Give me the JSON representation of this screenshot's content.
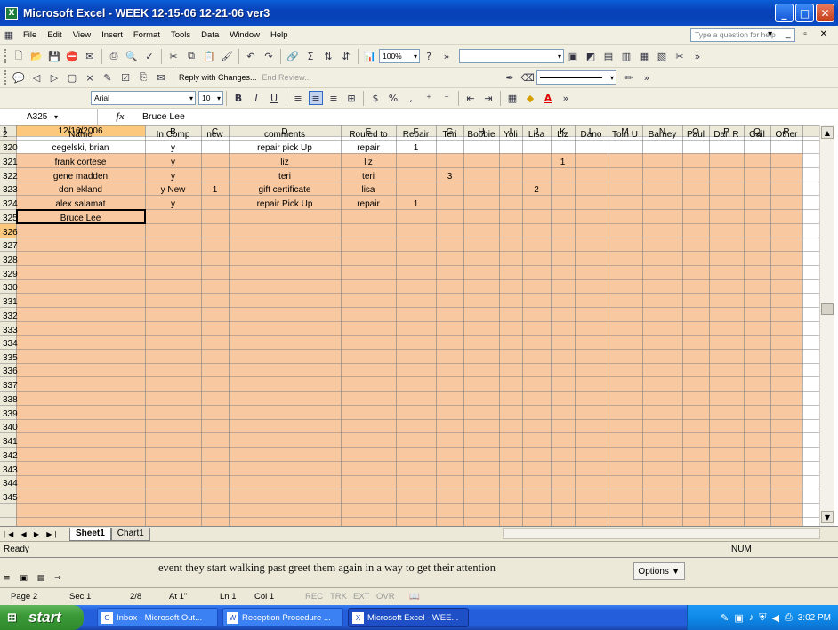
{
  "window": {
    "title": "Microsoft Excel - WEEK 12-15-06 12-21-06 ver3",
    "app_icon": "excel-icon"
  },
  "menu": {
    "items": [
      "File",
      "Edit",
      "View",
      "Insert",
      "Format",
      "Tools",
      "Data",
      "Window",
      "Help"
    ],
    "question_placeholder": "Type a question for help"
  },
  "toolbar": {
    "zoom": "100%",
    "reply_changes": "Reply with Changes...",
    "end_review": "End Review...",
    "font": "Arial",
    "font_size": "10"
  },
  "formula_bar": {
    "name_box": "A325",
    "fx": "fx",
    "value": "Bruce Lee"
  },
  "sheet": {
    "columns": [
      "A",
      "B",
      "C",
      "D",
      "E",
      "F",
      "G",
      "H",
      "I",
      "J",
      "K",
      "L",
      "M",
      "N",
      "O",
      "P",
      "Q",
      "R"
    ],
    "row1": {
      "num": "1",
      "date": "12/16/2006"
    },
    "headers": {
      "num": "2",
      "cells": [
        "Name",
        "In Comp",
        "new",
        "comments",
        "Routed to",
        "Repair",
        "Teri",
        "Bobbie",
        "Yoli",
        "Lisa",
        "Liz",
        "Dano",
        "Tom U",
        "Barney",
        "Paul",
        "Dan R",
        "Gail",
        "Other"
      ]
    },
    "rows": [
      {
        "num": "320",
        "name": "cegelski, brian",
        "in_comp": "y",
        "new": "",
        "comments": "repair pick Up",
        "routed": "repair",
        "marks": {
          "F": "1"
        }
      },
      {
        "num": "321",
        "name": "frank cortese",
        "in_comp": "y",
        "new": "",
        "comments": "liz",
        "routed": "liz",
        "marks": {
          "K": "1"
        }
      },
      {
        "num": "322",
        "name": "gene madden",
        "in_comp": "y",
        "new": "",
        "comments": "teri",
        "routed": "teri",
        "marks": {
          "G": "3"
        }
      },
      {
        "num": "323",
        "name": "don ekland",
        "in_comp": "y New",
        "new": "1",
        "comments": "gift certificate",
        "routed": "lisa",
        "marks": {
          "J": "2"
        }
      },
      {
        "num": "324",
        "name": "alex salamat",
        "in_comp": "y",
        "new": "",
        "comments": "repair Pick Up",
        "routed": "repair",
        "marks": {
          "F": "1"
        }
      },
      {
        "num": "325",
        "name": "Bruce Lee",
        "in_comp": "",
        "new": "",
        "comments": "",
        "routed": "",
        "marks": {}
      }
    ],
    "empty_rows": [
      "326",
      "327",
      "328",
      "329",
      "330",
      "331",
      "332",
      "333",
      "334",
      "335",
      "336",
      "337",
      "338",
      "339",
      "340",
      "341",
      "342",
      "343",
      "344",
      "345"
    ],
    "colors": {
      "fill": "#f8c8a0",
      "header_bg": "#ece9d8",
      "selected_header": "#fbc87d",
      "grid": "#000000"
    }
  },
  "tabs": [
    "Sheet1",
    "Chart1"
  ],
  "status": {
    "left": "Ready",
    "num": "NUM"
  },
  "word": {
    "text": "event they start walking past greet them again in a way to get their attention",
    "options": "Options ▼",
    "status": {
      "page": "Page 2",
      "sec": "Sec 1",
      "pages": "2/8",
      "at": "At 1\"",
      "ln": "Ln 1",
      "col": "Col 1",
      "rec": "REC",
      "trk": "TRK",
      "ext": "EXT",
      "ovr": "OVR"
    }
  },
  "taskbar": {
    "start": "start",
    "tasks": [
      {
        "label": "Inbox - Microsoft Out...",
        "icon": "outlook-icon"
      },
      {
        "label": "Reception Procedure ...",
        "icon": "word-icon"
      },
      {
        "label": "Microsoft Excel - WEE...",
        "icon": "excel-icon"
      }
    ],
    "clock": "3:02 PM"
  }
}
